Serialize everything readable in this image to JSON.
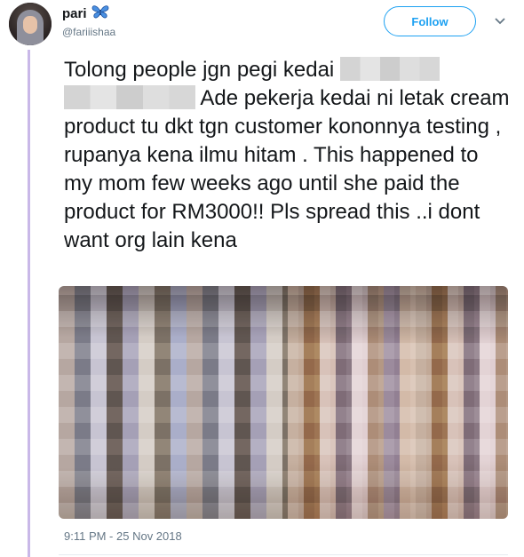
{
  "user": {
    "display_name": "pari",
    "badge_icon": "butterfly-icon",
    "handle": "@fariiishaa"
  },
  "actions": {
    "follow_label": "Follow",
    "menu_icon": "chevron-down-icon"
  },
  "tweet": {
    "line1_prefix": "Tolong people jgn pegi kedai",
    "body": " Ade pekerja kedai ni letak cream product tu dkt tgn customer kononnya testing , rupanya kena ilmu hitam . This happened to my mom few weeks ago until she paid the product for RM3000!! Pls spread this ..i dont want org lain kena",
    "timestamp": "9:11 PM - 25 Nov 2018"
  },
  "colors": {
    "accent": "#1da1f2",
    "thread_line": "#c9b8e8",
    "secondary_text": "#657786"
  }
}
